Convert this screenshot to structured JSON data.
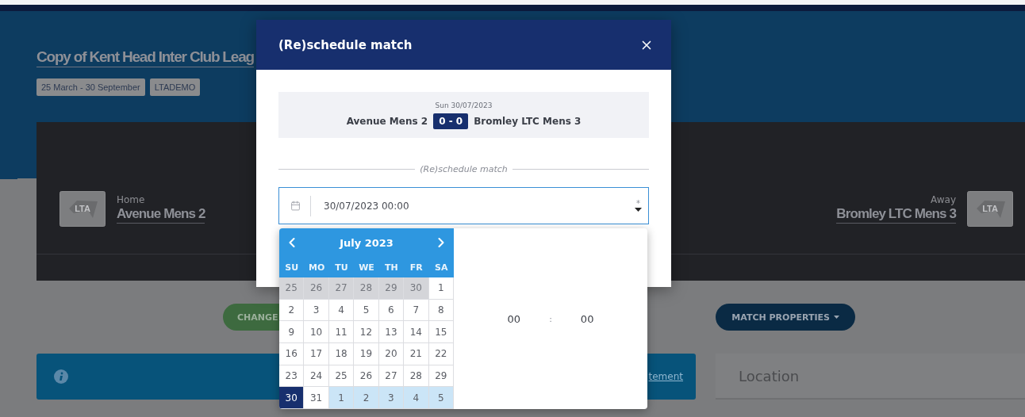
{
  "page": {
    "title": "Copy of Kent Head Inter Club Leag",
    "tags": [
      "25 March - 30 September",
      "LTADEMO"
    ],
    "home": {
      "label": "Home",
      "team": "Avenue Mens 2",
      "logo_text": "LTA"
    },
    "away": {
      "label": "Away",
      "team": "Bromley LTC Mens 3",
      "logo_text": "LTA"
    },
    "buttons": [
      {
        "label": "CHANGE",
        "kind": "change"
      },
      {
        "label": "MATCH PROPERTIES",
        "kind": "properties"
      }
    ],
    "info_banner": {
      "link": "tement"
    },
    "location_panel": {
      "title": "Location"
    }
  },
  "modal": {
    "title": "(Re)schedule match",
    "summary": {
      "date": "Sun 30/07/2023",
      "home": "Avenue Mens 2",
      "score": "0 - 0",
      "away": "Bromley LTC Mens 3"
    },
    "section_label": "(Re)schedule match",
    "datetime_field": {
      "value": "30/07/2023 00:00",
      "required_mark": "*"
    }
  },
  "datepicker": {
    "month": "July 2023",
    "weekdays": [
      "SU",
      "MO",
      "TU",
      "WE",
      "TH",
      "FR",
      "SA"
    ],
    "weeks": [
      [
        {
          "day": "25",
          "kind": "prev",
          "selected": false
        },
        {
          "day": "26",
          "kind": "prev",
          "selected": false
        },
        {
          "day": "27",
          "kind": "prev",
          "selected": false
        },
        {
          "day": "28",
          "kind": "prev",
          "selected": false
        },
        {
          "day": "29",
          "kind": "prev",
          "selected": false
        },
        {
          "day": "30",
          "kind": "prev",
          "selected": false
        },
        {
          "day": "1",
          "kind": "current",
          "selected": false
        }
      ],
      [
        {
          "day": "2",
          "kind": "current",
          "selected": false
        },
        {
          "day": "3",
          "kind": "current",
          "selected": false
        },
        {
          "day": "4",
          "kind": "current",
          "selected": false
        },
        {
          "day": "5",
          "kind": "current",
          "selected": false
        },
        {
          "day": "6",
          "kind": "current",
          "selected": false
        },
        {
          "day": "7",
          "kind": "current",
          "selected": false
        },
        {
          "day": "8",
          "kind": "current",
          "selected": false
        }
      ],
      [
        {
          "day": "9",
          "kind": "current",
          "selected": false
        },
        {
          "day": "10",
          "kind": "current",
          "selected": false
        },
        {
          "day": "11",
          "kind": "current",
          "selected": false
        },
        {
          "day": "12",
          "kind": "current",
          "selected": false
        },
        {
          "day": "13",
          "kind": "current",
          "selected": false
        },
        {
          "day": "14",
          "kind": "current",
          "selected": false
        },
        {
          "day": "15",
          "kind": "current",
          "selected": false
        }
      ],
      [
        {
          "day": "16",
          "kind": "current",
          "selected": false
        },
        {
          "day": "17",
          "kind": "current",
          "selected": false
        },
        {
          "day": "18",
          "kind": "current",
          "selected": false
        },
        {
          "day": "19",
          "kind": "current",
          "selected": false
        },
        {
          "day": "20",
          "kind": "current",
          "selected": false
        },
        {
          "day": "21",
          "kind": "current",
          "selected": false
        },
        {
          "day": "22",
          "kind": "current",
          "selected": false
        }
      ],
      [
        {
          "day": "23",
          "kind": "current",
          "selected": false
        },
        {
          "day": "24",
          "kind": "current",
          "selected": false
        },
        {
          "day": "25",
          "kind": "current",
          "selected": false
        },
        {
          "day": "26",
          "kind": "current",
          "selected": false
        },
        {
          "day": "27",
          "kind": "current",
          "selected": false
        },
        {
          "day": "28",
          "kind": "current",
          "selected": false
        },
        {
          "day": "29",
          "kind": "current",
          "selected": false
        }
      ],
      [
        {
          "day": "30",
          "kind": "current",
          "selected": true
        },
        {
          "day": "31",
          "kind": "current",
          "selected": false
        },
        {
          "day": "1",
          "kind": "next",
          "selected": false
        },
        {
          "day": "2",
          "kind": "next",
          "selected": false
        },
        {
          "day": "3",
          "kind": "next",
          "selected": false
        },
        {
          "day": "4",
          "kind": "next",
          "selected": false
        },
        {
          "day": "5",
          "kind": "next",
          "selected": false
        }
      ]
    ],
    "time": {
      "hours": "00",
      "separator": ":",
      "minutes": "00"
    }
  }
}
